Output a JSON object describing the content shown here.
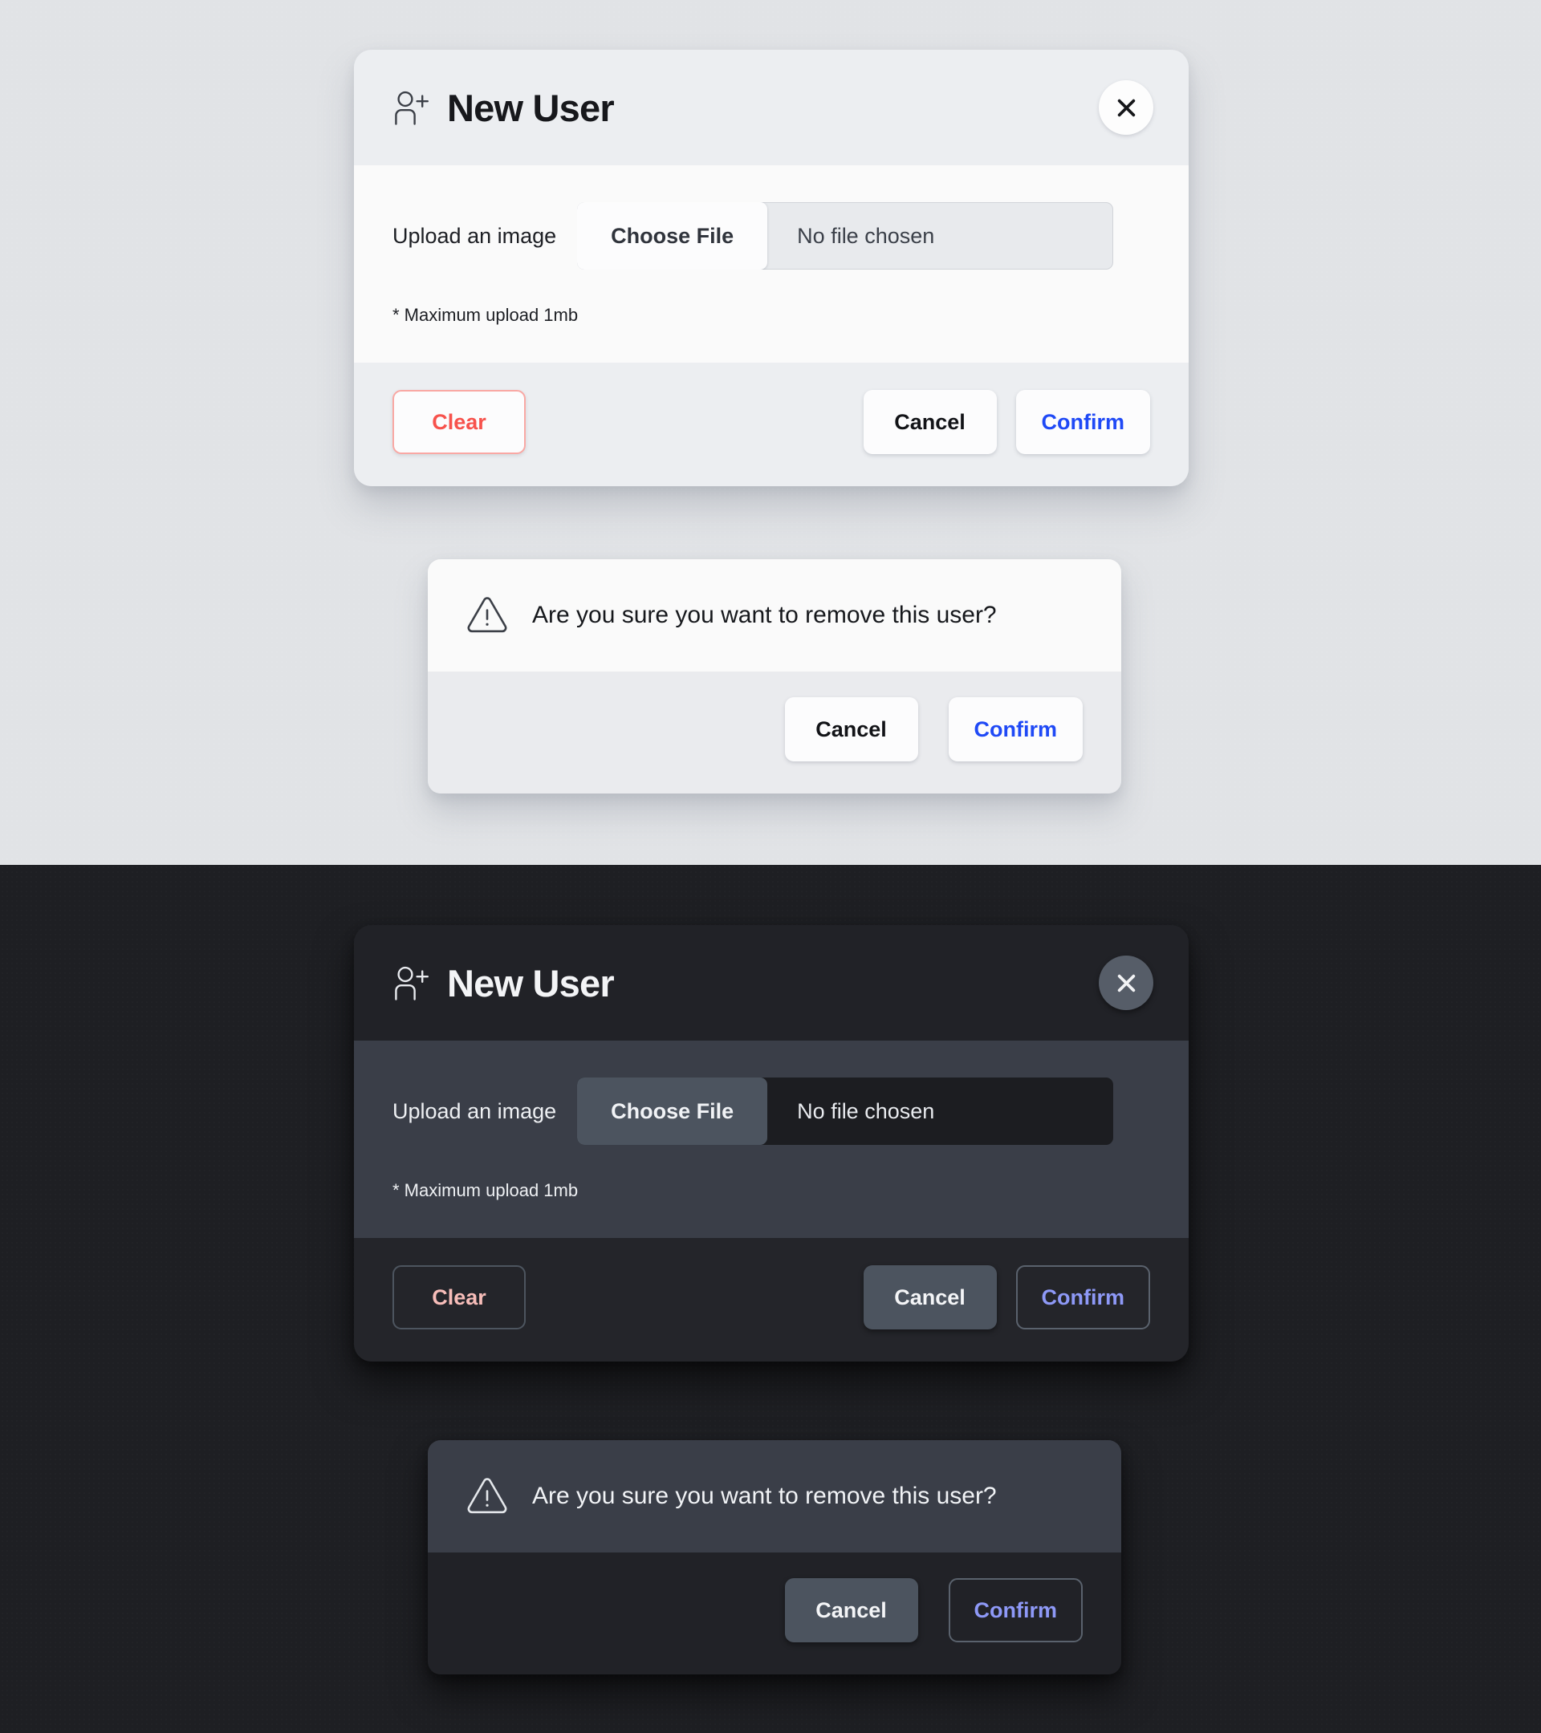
{
  "themes": [
    {
      "name": "light",
      "modal": {
        "title": "New User",
        "icon": "user-plus-icon",
        "close_icon": "close-icon",
        "upload_label": "Upload an image",
        "choose_file_label": "Choose File",
        "file_status": "No file chosen",
        "upload_note": "* Maximum upload 1mb",
        "clear_label": "Clear",
        "cancel_label": "Cancel",
        "confirm_label": "Confirm"
      },
      "dialog": {
        "icon": "warning-triangle-icon",
        "message": "Are you sure you want to remove this user?",
        "cancel_label": "Cancel",
        "confirm_label": "Confirm"
      }
    },
    {
      "name": "dark",
      "modal": {
        "title": "New User",
        "icon": "user-plus-icon",
        "close_icon": "close-icon",
        "upload_label": "Upload an image",
        "choose_file_label": "Choose File",
        "file_status": "No file chosen",
        "upload_note": "* Maximum upload 1mb",
        "clear_label": "Clear",
        "cancel_label": "Cancel",
        "confirm_label": "Confirm"
      },
      "dialog": {
        "icon": "warning-triangle-icon",
        "message": "Are you sure you want to remove this user?",
        "cancel_label": "Cancel",
        "confirm_label": "Confirm"
      }
    }
  ],
  "colors": {
    "light_background": "#e1e3e6",
    "dark_background": "#1e1f23",
    "light_surface": "#fafafa",
    "light_header": "#eceef1",
    "dark_surface": "#3a3e48",
    "dark_header": "#212227",
    "danger": "#f7524c",
    "danger_border": "#f9a8a4",
    "danger_dark": "#f7bdb9",
    "accent": "#1f49f6",
    "accent_dark": "#8e99f7"
  }
}
